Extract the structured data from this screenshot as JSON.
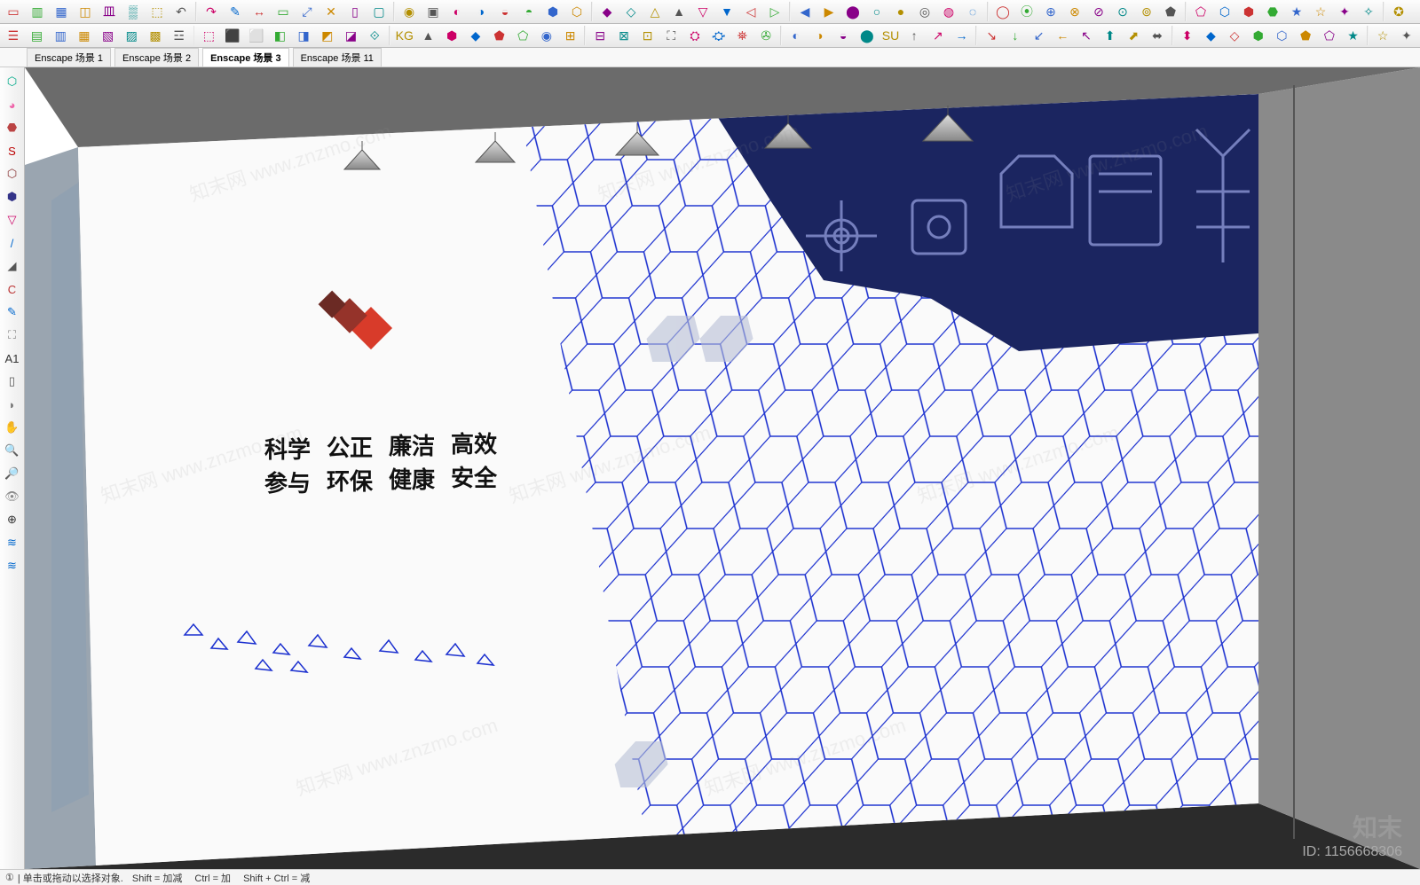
{
  "tabs": {
    "items": [
      {
        "label": "Enscape 场景 1",
        "active": false
      },
      {
        "label": "Enscape 场景 2",
        "active": false
      },
      {
        "label": "Enscape 场景 3",
        "active": true
      },
      {
        "label": "Enscape 场景 11",
        "active": false
      }
    ]
  },
  "wall_text": {
    "row1": [
      "科学",
      "公正",
      "廉洁",
      "高效"
    ],
    "row2": [
      "参与",
      "环保",
      "健康",
      "安全"
    ]
  },
  "watermark": {
    "brand": "知末",
    "id_label": "ID: 1156668306",
    "diag": "知末网 www.znzmo.com"
  },
  "status_bar": {
    "hint": "单击或拖动以选择对象",
    "k1": "Shift = 加减",
    "k2": "Ctrl = 加",
    "k3": "Shift + Ctrl = 减"
  },
  "colors": {
    "hex_stroke": "#1a2fcf",
    "dark_area": "#1b2560",
    "floor": "#2b2b2b",
    "ceiling": "#6b6b6b",
    "accent_red": "#d83b2a",
    "wall": "#fafafa"
  },
  "toolbar_top": {
    "r1": [
      "▭",
      "▥",
      "▦",
      "◫",
      "皿",
      "▒",
      "⬚",
      "↶",
      "↷",
      "✎",
      "↔",
      "▭",
      "⤢",
      "✕",
      "▯",
      "▢",
      "◉",
      "▣",
      "◐",
      "◑",
      "◒",
      "◓",
      "⬢",
      "⬡",
      "◆",
      "◇",
      "△",
      "▲",
      "▽",
      "▼",
      "◁",
      "▷",
      "◀",
      "▶",
      "⬤",
      "○",
      "●",
      "◎",
      "◍",
      "◌",
      "◯",
      "⦿",
      "⊕",
      "⊗",
      "⊘",
      "⊙",
      "⊚",
      "⬟",
      "⬠",
      "⬡",
      "⬢",
      "⬣",
      "★",
      "☆",
      "✦",
      "✧",
      "✪"
    ],
    "r2": [
      "☰",
      "▤",
      "▥",
      "▦",
      "▧",
      "▨",
      "▩",
      "☲",
      "⬚",
      "⬛",
      "⬜",
      "◧",
      "◨",
      "◩",
      "◪",
      "⟐",
      "KG",
      "▲",
      "⬢",
      "◆",
      "⬟",
      "⬠",
      "◉",
      "⊞",
      "⊟",
      "⊠",
      "⊡",
      "⛶",
      "⛭",
      "⛮",
      "⛯",
      "✇",
      "◐",
      "◑",
      "◒",
      "⬤",
      "SU",
      "↑",
      "↗",
      "→",
      "↘",
      "↓",
      "↙",
      "←",
      "↖",
      "⬆",
      "⬈",
      "⬌",
      "⬍",
      "◆",
      "◇",
      "⬢",
      "⬡",
      "⬟",
      "⬠",
      "★",
      "☆",
      "✦"
    ]
  },
  "left_tools": [
    "⬡",
    "◕",
    "⬣",
    "S",
    "⬡",
    "⬢",
    "▽",
    "/",
    "◢",
    "C",
    "✎",
    "⛶",
    "A1",
    "▯",
    "◗",
    "✋",
    "🔍",
    "🔎",
    "👁",
    "⊕",
    "≋",
    "≋"
  ]
}
